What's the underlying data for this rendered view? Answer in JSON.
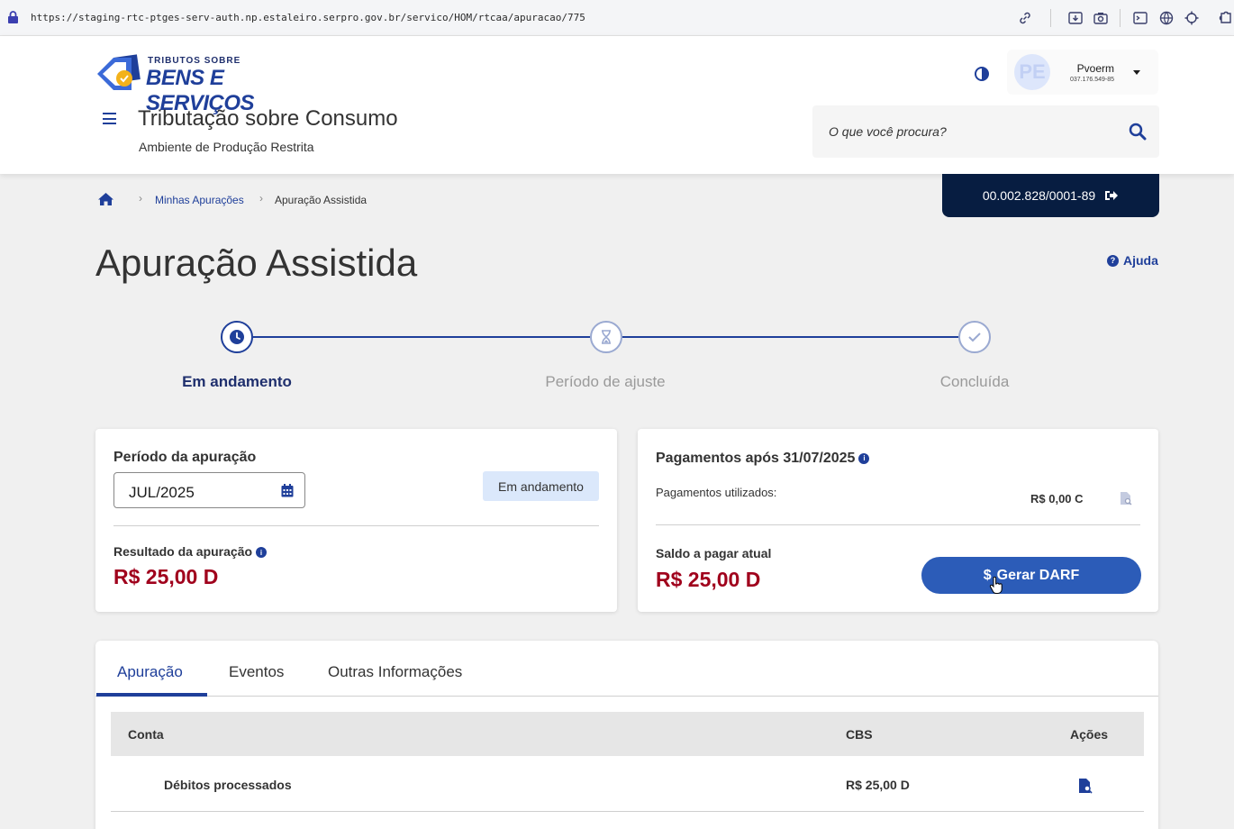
{
  "browser": {
    "url": "https://staging-rtc-ptges-serv-auth.np.estaleiro.serpro.gov.br/servico/HOM/rtcaa/apuracao/775"
  },
  "header": {
    "logo_small": "TRIBUTOS SOBRE",
    "logo_big": "BENS E SERVIÇOS",
    "system_title": "Tributação sobre Consumo",
    "system_subtitle": "Ambiente de Produção Restrita",
    "search_placeholder": "O que você procura?",
    "user": {
      "initials": "PE",
      "name": "Pvoerm",
      "document": "037.176.549-85"
    }
  },
  "company": {
    "cnpj": "00.002.828/0001-89"
  },
  "breadcrumb": {
    "items": [
      "Minhas Apurações",
      "Apuração Assistida"
    ]
  },
  "page": {
    "title": "Apuração Assistida",
    "help_label": "Ajuda"
  },
  "stepper": {
    "steps": [
      {
        "label": "Em andamento",
        "state": "active"
      },
      {
        "label": "Período de ajuste",
        "state": "pending"
      },
      {
        "label": "Concluída",
        "state": "pending"
      }
    ]
  },
  "period_card": {
    "label": "Período da apuração",
    "value": "JUL/2025",
    "status": "Em andamento",
    "result_label": "Resultado da apuração",
    "result_value": "R$ 25,00 D"
  },
  "payments_card": {
    "title": "Pagamentos após 31/07/2025",
    "used_label": "Pagamentos utilizados:",
    "used_value": "R$ 0,00 C",
    "balance_label": "Saldo a pagar atual",
    "balance_value": "R$ 25,00 D",
    "darf_button": "Gerar DARF",
    "darf_symbol": "$"
  },
  "tabs": [
    "Apuração",
    "Eventos",
    "Outras Informações"
  ],
  "table": {
    "headers": [
      "Conta",
      "CBS",
      "Ações"
    ],
    "rows": [
      {
        "conta": "Débitos processados",
        "cbs": "R$ 25,00 D"
      }
    ]
  },
  "colors": {
    "primary": "#1f3f9a",
    "dark": "#071d41",
    "debit_red": "#a0001c",
    "button_blue": "#2c5cb8",
    "badge_bg": "#dbe8fb"
  }
}
